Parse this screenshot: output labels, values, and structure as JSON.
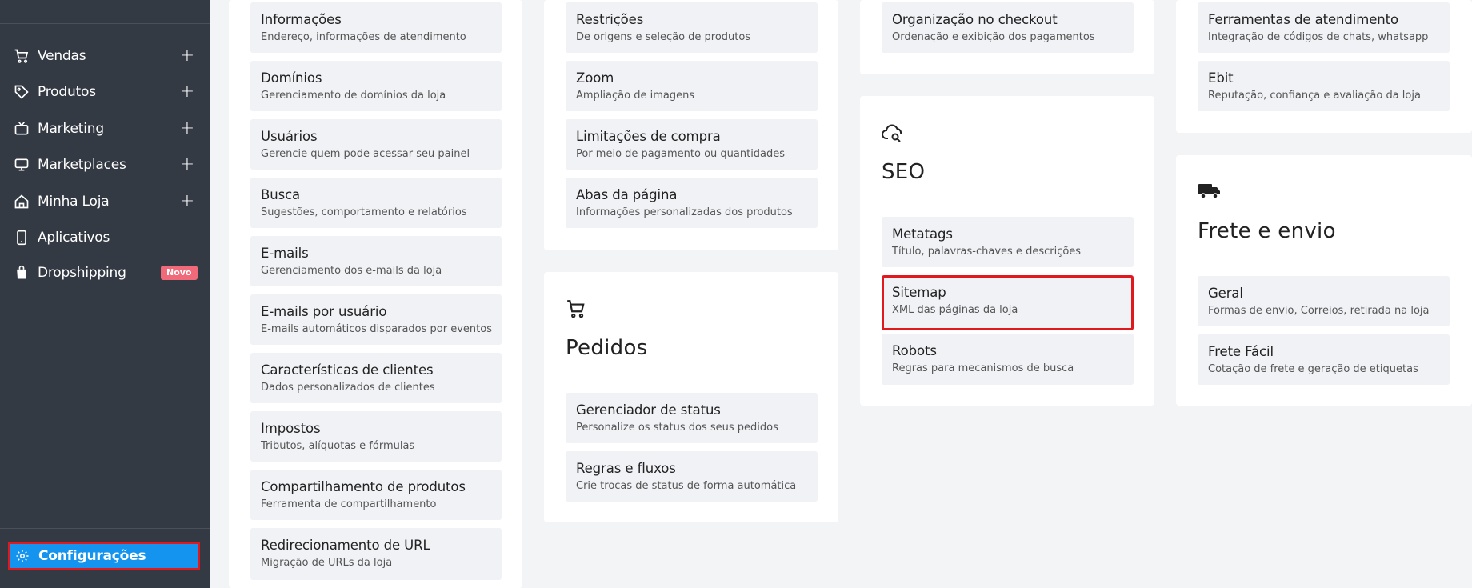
{
  "sidebar": {
    "items": [
      {
        "label": "Vendas",
        "icon": "cart-icon",
        "expandable": true
      },
      {
        "label": "Produtos",
        "icon": "tag-icon",
        "expandable": true
      },
      {
        "label": "Marketing",
        "icon": "tv-icon",
        "expandable": true
      },
      {
        "label": "Marketplaces",
        "icon": "monitor-icon",
        "expandable": true
      },
      {
        "label": "Minha Loja",
        "icon": "home-icon",
        "expandable": true
      },
      {
        "label": "Aplicativos",
        "icon": "phone-icon",
        "expandable": false
      },
      {
        "label": "Dropshipping",
        "icon": "bag-icon",
        "expandable": false,
        "badge": "Novo"
      }
    ],
    "plus": "+",
    "config_label": "Configurações"
  },
  "col1": {
    "items": [
      {
        "title": "Informações",
        "desc": "Endereço, informações de atendimento"
      },
      {
        "title": "Domínios",
        "desc": "Gerenciamento de domínios da loja"
      },
      {
        "title": "Usuários",
        "desc": "Gerencie quem pode acessar seu painel"
      },
      {
        "title": "Busca",
        "desc": "Sugestões, comportamento e relatórios"
      },
      {
        "title": "E-mails",
        "desc": "Gerenciamento dos e-mails da loja"
      },
      {
        "title": "E-mails por usuário",
        "desc": "E-mails automáticos disparados por eventos"
      },
      {
        "title": "Características de clientes",
        "desc": "Dados personalizados de clientes"
      },
      {
        "title": "Impostos",
        "desc": "Tributos, alíquotas e fórmulas"
      },
      {
        "title": "Compartilhamento de produtos",
        "desc": "Ferramenta de compartilhamento"
      },
      {
        "title": "Redirecionamento de URL",
        "desc": "Migração de URLs da loja"
      }
    ]
  },
  "col2": {
    "items": [
      {
        "title": "Restrições",
        "desc": "De origens e seleção de produtos"
      },
      {
        "title": "Zoom",
        "desc": "Ampliação de imagens"
      },
      {
        "title": "Limitações de compra",
        "desc": "Por meio de pagamento ou quantidades"
      },
      {
        "title": "Abas da página",
        "desc": "Informações personalizadas dos produtos"
      }
    ],
    "pedidos": {
      "title": "Pedidos",
      "items": [
        {
          "title": "Gerenciador de status",
          "desc": "Personalize os status dos seus pedidos"
        },
        {
          "title": "Regras e fluxos",
          "desc": "Crie trocas de status de forma automática"
        }
      ]
    }
  },
  "col3": {
    "items": [
      {
        "title": "Organização no checkout",
        "desc": "Ordenação e exibição dos pagamentos"
      }
    ],
    "seo": {
      "title": "SEO",
      "items": [
        {
          "title": "Metatags",
          "desc": "Título, palavras-chaves e descrições"
        },
        {
          "title": "Sitemap",
          "desc": "XML das páginas da loja"
        },
        {
          "title": "Robots",
          "desc": "Regras para mecanismos de busca"
        }
      ]
    }
  },
  "col4": {
    "items": [
      {
        "title": "Ferramentas de atendimento",
        "desc": "Integração de códigos de chats, whatsapp"
      },
      {
        "title": "Ebit",
        "desc": "Reputação, confiança e avaliação da loja"
      }
    ],
    "frete": {
      "title": "Frete e envio",
      "items": [
        {
          "title": "Geral",
          "desc": "Formas de envio, Correios, retirada na loja"
        },
        {
          "title": "Frete Fácil",
          "desc": "Cotação de frete e geração de etiquetas"
        }
      ]
    }
  },
  "colors": {
    "sidebar": "#343a44",
    "accent": "#1594ef",
    "highlight": "#e0191f",
    "badge": "#f06a7a"
  }
}
